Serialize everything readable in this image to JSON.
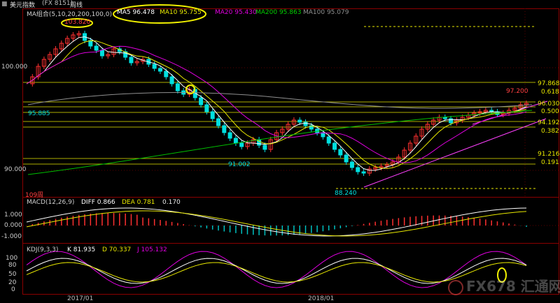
{
  "header": {
    "title": "美元指数",
    "code": "(FX 8151)",
    "period": "周线"
  },
  "main_legend": [
    {
      "text": "MA组合(5,10,20,200,100,0)",
      "color": "#cfcfcf"
    },
    {
      "text": "MA5 96.478",
      "color": "#ffffff"
    },
    {
      "text": "MA10 95.755",
      "color": "#e8e800"
    },
    {
      "text": "MA20 95.430",
      "color": "#e000e0"
    },
    {
      "text": "MA200 95.863",
      "color": "#00d000"
    },
    {
      "text": "MA100 95.079",
      "color": "#909090"
    }
  ],
  "main_axis": {
    "labels": [
      "100.000",
      "90.000"
    ]
  },
  "annotations": {
    "high": "103.820",
    "lows": [
      "95.885",
      "91.002",
      "88.240"
    ],
    "recent": "97.200",
    "weeks": "109周"
  },
  "fib_levels": [
    {
      "price": "97.868",
      "ratio": "0.618"
    },
    {
      "price": "96.030",
      "ratio": "0.500"
    },
    {
      "price": "94.192",
      "ratio": "0.382"
    },
    {
      "price": "91.216",
      "ratio": "0.191"
    }
  ],
  "macd": {
    "legend": [
      {
        "text": "MACD(12,26,9)",
        "color": "#cfcfcf"
      },
      {
        "text": "DIFF 0.866",
        "color": "#ffffff"
      },
      {
        "text": "DEA 0.781",
        "color": "#e8e800"
      },
      {
        "text": "0.170",
        "color": "#e8e8e8"
      }
    ],
    "axis": [
      "1.000",
      "0.000",
      "-1.000"
    ]
  },
  "kdj": {
    "legend": [
      {
        "text": "KDJ(9,3,3)",
        "color": "#cfcfcf"
      },
      {
        "text": "K 81.935",
        "color": "#ffffff"
      },
      {
        "text": "D 70.337",
        "color": "#e8e800"
      },
      {
        "text": "J 105.132",
        "color": "#e000e0"
      }
    ],
    "axis": [
      "100",
      "80",
      "50",
      "20",
      "0"
    ]
  },
  "time_axis": [
    "2017/01",
    "2018/01"
  ],
  "watermark": "FX678 汇通网",
  "colors": {
    "up": "#ff3030",
    "down": "#00e0e0",
    "grid": "#8b0000"
  }
}
